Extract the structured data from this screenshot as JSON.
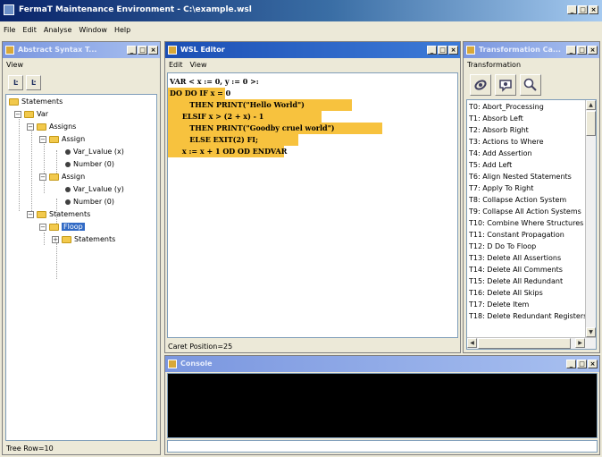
{
  "app": {
    "title": "FermaT Maintenance Environment - C:\\example.wsl",
    "menu": [
      "File",
      "Edit",
      "Analyse",
      "Window",
      "Help"
    ]
  },
  "window_buttons": {
    "minimize": "_",
    "maximize": "□",
    "close": "×"
  },
  "ast_frame": {
    "title": "Abstract Syntax T...",
    "menu": [
      "View"
    ],
    "toolbar": [
      "Ŀ",
      "Ŀ"
    ],
    "tree": [
      {
        "label": "Statements"
      },
      {
        "label": "Var"
      },
      {
        "label": "Assigns"
      },
      {
        "label": "Assign"
      },
      {
        "label": "Var_Lvalue (x)"
      },
      {
        "label": "Number (0)"
      },
      {
        "label": "Assign"
      },
      {
        "label": "Var_Lvalue (y)"
      },
      {
        "label": "Number (0)"
      },
      {
        "label": "Statements"
      },
      {
        "label": "Floop"
      },
      {
        "label": "Statements"
      }
    ],
    "status": "Tree Row=10"
  },
  "wsl_editor": {
    "title": "WSL Editor",
    "menu": [
      "Edit",
      "View"
    ],
    "code": [
      "VAR < x := 0, y := 0 >:",
      "DO DO IF x = 0",
      "        THEN PRINT(\"Hello World\")",
      "     ELSIF x > (2 + x) - 1",
      "        THEN PRINT(\"Goodby cruel world\")",
      "        ELSE EXIT(2) FI;",
      "     x := x + 1 OD OD ENDVAR"
    ],
    "caret_status": "Caret Position=25"
  },
  "transformation_catalogue": {
    "title": "Transformation Ca...",
    "menu": [
      "Transformation"
    ],
    "toolbar_icons": [
      "apply-transformation-icon",
      "test-transformation-icon",
      "search-transformation-icon"
    ],
    "items": [
      "T0: Abort_Processing",
      "T1: Absorb Left",
      "T2: Absorb Right",
      "T3: Actions to Where",
      "T4: Add Assertion",
      "T5: Add Left",
      "T6: Align Nested Statements",
      "T7: Apply To Right",
      "T8: Collapse Action System",
      "T9: Collapse All Action Systems",
      "T10: Combine Where Structures",
      "T11: Constant Propagation",
      "T12: D Do To Floop",
      "T13: Delete All Assertions",
      "T14: Delete All Comments",
      "T15: Delete All Redundant",
      "T16: Delete All Skips",
      "T17: Delete Item",
      "T18: Delete Redundant Registers"
    ]
  },
  "console": {
    "title": "Console"
  },
  "colors": {
    "title_active": "#1c4fb4",
    "title_inactive": "#7a96df",
    "code_highlight": "#f7c23e",
    "selection": "#316ac5",
    "console_bg": "#000000"
  }
}
